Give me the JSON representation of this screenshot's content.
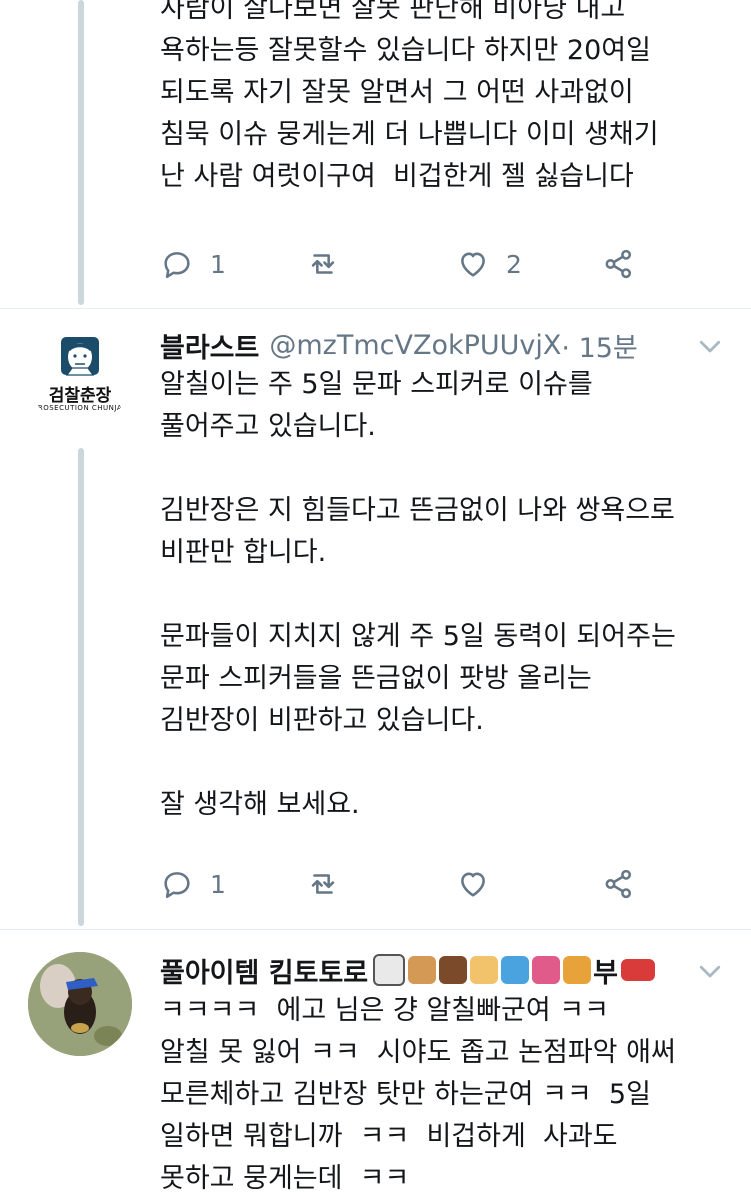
{
  "tweets": [
    {
      "body": "사람이 살다보면 잘못 판단해 비아냥 내고\n욕하는등 잘못할수 있습니다 하지만 20여일\n되도록 자기 잘못 알면서 그 어떤 사과없이\n침묵 이슈 뭉게는게 더 나쁩니다 이미 생채기\n난 사람 여럿이구여  비겁한게 젤 싫습니다",
      "reply_count": "1",
      "retweet_count": "",
      "like_count": "2"
    },
    {
      "name": "블라스트",
      "handle": "@mzTmcVZokPUUvjX",
      "time": " · 15분",
      "avatar_text": "검찰춘장",
      "avatar_subtext": "ROSECUTION CHUNJA",
      "body": "알칠이는 주 5일 문파 스피커로 이슈를\n풀어주고 있습니다.\n\n김반장은 지 힘들다고 뜬금없이 나와 쌍욕으로\n비판만 합니다.\n\n문파들이 지치지 않게 주 5일 동력이 되어주는\n문파 스피커들을 뜬금없이 팟방 올리는\n김반장이 비판하고 있습니다.\n\n잘 생각해 보세요.",
      "reply_count": "1",
      "retweet_count": "",
      "like_count": ""
    },
    {
      "name": "풀아이템 킴토토로",
      "name_suffix": "부",
      "emoji_icons": [
        "dog-face-icon",
        "dog-icon",
        "paw-prints-icon",
        "scientist-icon",
        "swimmer-icon",
        "runner-icon",
        "cyclist-icon",
        "car-icon"
      ],
      "body": "ㅋㅋㅋㅋ  에고 님은 걍 알칠빠군여 ㅋㅋ\n알칠 못 잃어 ㅋㅋ  시야도 좁고 논점파악 애써\n모른체하고 김반장 탓만 하는군여 ㅋㅋ  5일\n일하면 뭐합니까  ㅋㅋ  비겁하게  사과도\n못하고 뭉게는데  ㅋㅋ"
    }
  ],
  "colors": {
    "text": "#14171a",
    "secondary": "#657786",
    "thread_line": "#ccd6dd",
    "divider": "#e6ecf0"
  }
}
